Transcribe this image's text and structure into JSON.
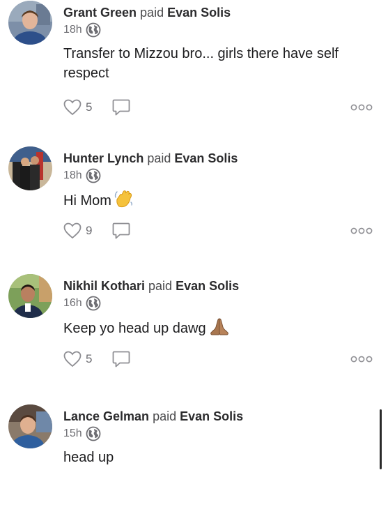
{
  "connector": "paid",
  "posts": [
    {
      "author": "Grant Green",
      "recipient": "Evan Solis",
      "time": "18h",
      "message_lines": [
        "Transfer to Mizzou bro... girls there have self",
        "respect"
      ],
      "likes": "5"
    },
    {
      "author": "Hunter Lynch",
      "recipient": "Evan Solis",
      "time": "18h",
      "message_lines": [
        "Hi Mom"
      ],
      "emoji": "waving-hand",
      "likes": "9"
    },
    {
      "author": "Nikhil Kothari",
      "recipient": "Evan Solis",
      "time": "16h",
      "message_lines": [
        "Keep yo head up dawg"
      ],
      "emoji": "folded-hands",
      "likes": "5"
    },
    {
      "author": "Lance Gelman",
      "recipient": "Evan Solis",
      "time": "15h",
      "message_lines": [
        "head up"
      ]
    }
  ],
  "icons": {
    "privacy": "globe-icon",
    "like": "heart-icon",
    "comment": "comment-icon",
    "more": "more-options-icon"
  },
  "colors": {
    "text_primary": "#1c1c1e",
    "text_secondary": "#6e6e73",
    "icon_gray": "#8e8e93"
  }
}
